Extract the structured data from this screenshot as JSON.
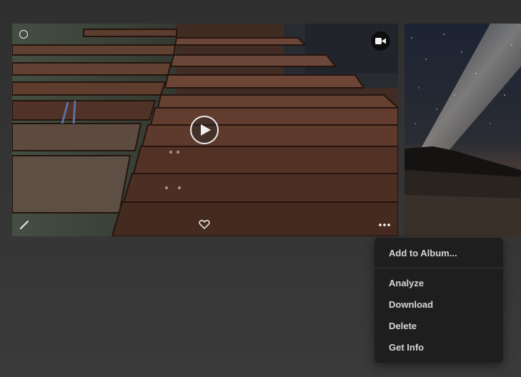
{
  "photo_card": {
    "selection": "select-circle",
    "badge_icon": "video-camera-icon",
    "play_icon": "play-icon",
    "actions": {
      "edit_icon": "pencil-icon",
      "favorite_icon": "heart-icon",
      "more_icon": "more-icon"
    }
  },
  "context_menu": {
    "items": [
      {
        "label": "Add to Album..."
      },
      {
        "label": "Analyze"
      },
      {
        "label": "Download"
      },
      {
        "label": "Delete"
      },
      {
        "label": "Get Info"
      }
    ]
  },
  "colors": {
    "background": "#333333",
    "menu_background": "#1e1e1e",
    "menu_text": "#d6d6d6"
  }
}
